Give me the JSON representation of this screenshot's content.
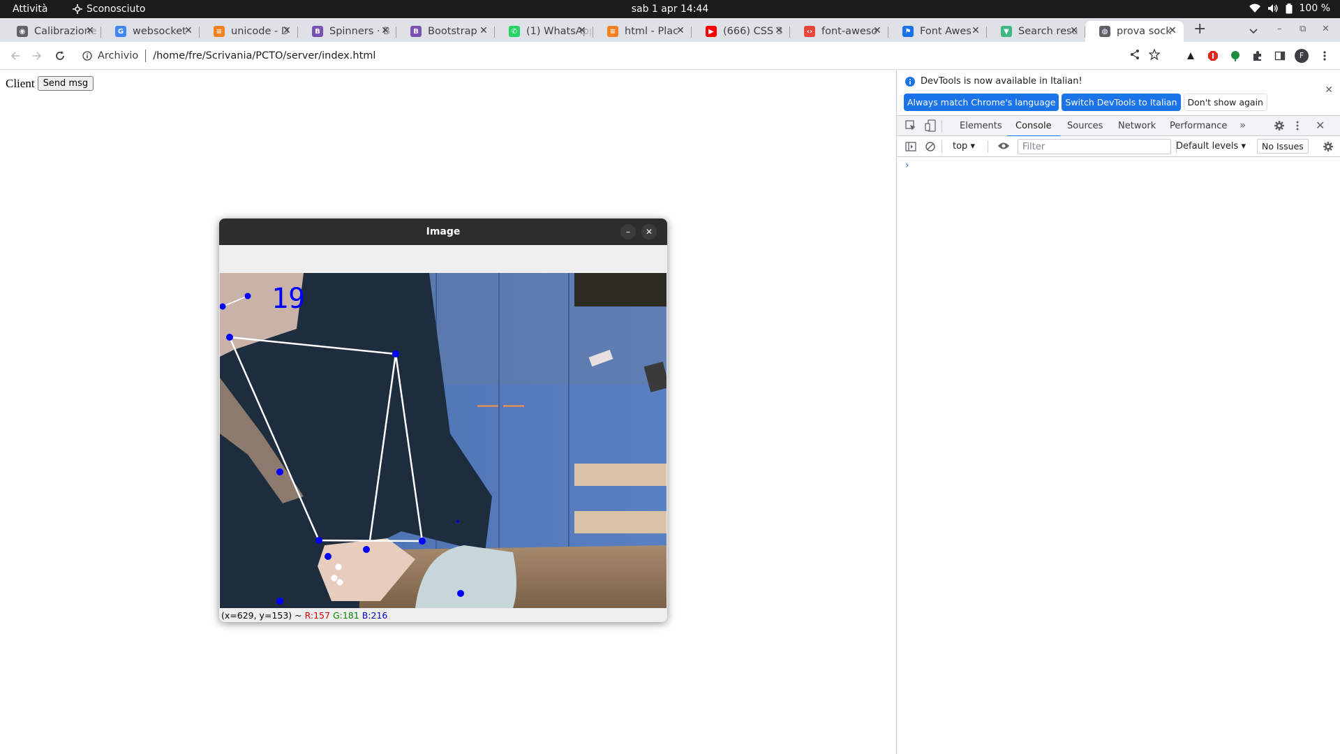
{
  "topbar": {
    "activities": "Attività",
    "app_name": "Sconosciuto",
    "clock": "sab 1 apr  14:44",
    "battery": "100 %"
  },
  "tabs": [
    {
      "title": "Calibrazione",
      "icon": "chrome-icon",
      "color": "#5f6368"
    },
    {
      "title": "websocket",
      "icon": "google-icon",
      "color": "#4285f4"
    },
    {
      "title": "unicode - D",
      "icon": "stackoverflow-icon",
      "color": "#f48024"
    },
    {
      "title": "Spinners · B",
      "icon": "bootstrap-icon",
      "color": "#7952b3"
    },
    {
      "title": "Bootstrap",
      "icon": "bootstrap-icon",
      "color": "#7952b3"
    },
    {
      "title": "(1) WhatsApp",
      "icon": "whatsapp-icon",
      "color": "#25d366"
    },
    {
      "title": "html - Plac",
      "icon": "stackoverflow-icon",
      "color": "#f48024"
    },
    {
      "title": "(666) CSS 3",
      "icon": "youtube-icon",
      "color": "#ff0000"
    },
    {
      "title": "font-aweso",
      "icon": "code-icon",
      "color": "#e8453c"
    },
    {
      "title": "Font Awes",
      "icon": "flag-icon",
      "color": "#1a73e8"
    },
    {
      "title": "Search resu",
      "icon": "vue-icon",
      "color": "#41b883"
    },
    {
      "title": "prova sock",
      "icon": "globe-icon",
      "color": "#5f6368",
      "active": true
    }
  ],
  "toolbar": {
    "scheme": "Archivio",
    "url": "/home/fre/Scrivania/PCTO/server/index.html",
    "profile_initial": "F"
  },
  "page": {
    "label": "Client",
    "button": "Send msg"
  },
  "devtools": {
    "notice": "DevTools is now available in Italian!",
    "btn_match": "Always match Chrome's language",
    "btn_switch": "Switch DevTools to Italian",
    "btn_dont": "Don't show again",
    "tabs": [
      "Elements",
      "Console",
      "Sources",
      "Network",
      "Performance"
    ],
    "active_tab": "Console",
    "context": "top",
    "filter_placeholder": "Filter",
    "levels": "Default levels",
    "issues": "No Issues"
  },
  "cv_window": {
    "title": "Image",
    "overlay_number": "19",
    "status_prefix": "(x=629, y=153) ~",
    "status_r": "R:157",
    "status_g": "G:181",
    "status_b": "B:216"
  }
}
